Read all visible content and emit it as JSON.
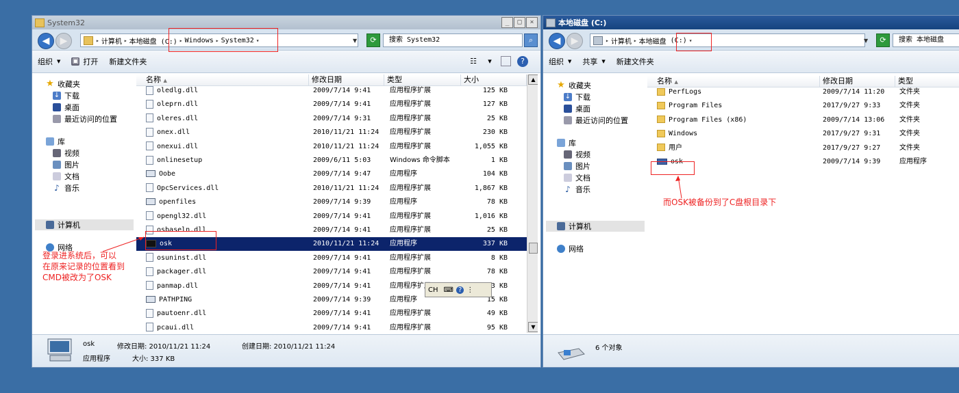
{
  "left_window": {
    "title": "System32",
    "address": [
      "计算机",
      "本地磁盘 (C:)",
      "Windows",
      "System32"
    ],
    "search_placeholder": "搜索 System32",
    "toolbar": {
      "organize": "组织",
      "open": "打开",
      "new_folder": "新建文件夹"
    },
    "nav": {
      "favorites": "收藏夹",
      "favorites_items": [
        "下载",
        "桌面",
        "最近访问的位置"
      ],
      "libraries": "库",
      "libraries_items": [
        "视频",
        "图片",
        "文档",
        "音乐"
      ],
      "computer": "计算机",
      "network": "网络"
    },
    "columns": {
      "name": "名称",
      "date": "修改日期",
      "type": "类型",
      "size": "大小"
    },
    "rows": [
      {
        "name": "oledlg.dll",
        "date": "2009/7/14 9:41",
        "type": "应用程序扩展",
        "size": "125 KB",
        "icon": "dll"
      },
      {
        "name": "oleprn.dll",
        "date": "2009/7/14 9:41",
        "type": "应用程序扩展",
        "size": "127 KB",
        "icon": "dll"
      },
      {
        "name": "oleres.dll",
        "date": "2009/7/14 9:31",
        "type": "应用程序扩展",
        "size": "25 KB",
        "icon": "dll"
      },
      {
        "name": "onex.dll",
        "date": "2010/11/21 11:24",
        "type": "应用程序扩展",
        "size": "230 KB",
        "icon": "dll"
      },
      {
        "name": "onexui.dll",
        "date": "2010/11/21 11:24",
        "type": "应用程序扩展",
        "size": "1,055 KB",
        "icon": "dll"
      },
      {
        "name": "onlinesetup",
        "date": "2009/6/11 5:03",
        "type": "Windows 命令脚本",
        "size": "1 KB",
        "icon": "dll"
      },
      {
        "name": "Oobe",
        "date": "2009/7/14 9:47",
        "type": "应用程序",
        "size": "104 KB",
        "icon": "exe"
      },
      {
        "name": "OpcServices.dll",
        "date": "2010/11/21 11:24",
        "type": "应用程序扩展",
        "size": "1,867 KB",
        "icon": "dll"
      },
      {
        "name": "openfiles",
        "date": "2009/7/14 9:39",
        "type": "应用程序",
        "size": "78 KB",
        "icon": "exe"
      },
      {
        "name": "opengl32.dll",
        "date": "2009/7/14 9:41",
        "type": "应用程序扩展",
        "size": "1,016 KB",
        "icon": "dll"
      },
      {
        "name": "osbaseln.dll",
        "date": "2009/7/14 9:41",
        "type": "应用程序扩展",
        "size": "25 KB",
        "icon": "dll"
      },
      {
        "name": "osk",
        "date": "2010/11/21 11:24",
        "type": "应用程序",
        "size": "337 KB",
        "icon": "cmd",
        "selected": true
      },
      {
        "name": "osuninst.dll",
        "date": "2009/7/14 9:41",
        "type": "应用程序扩展",
        "size": "8 KB",
        "icon": "dll"
      },
      {
        "name": "packager.dll",
        "date": "2009/7/14 9:41",
        "type": "应用程序扩展",
        "size": "78 KB",
        "icon": "dll"
      },
      {
        "name": "panmap.dll",
        "date": "2009/7/14 9:41",
        "type": "应用程序扩展",
        "size": "13 KB",
        "icon": "dll"
      },
      {
        "name": "PATHPING",
        "date": "2009/7/14 9:39",
        "type": "应用程序",
        "size": "15 KB",
        "icon": "exe"
      },
      {
        "name": "pautoenr.dll",
        "date": "2009/7/14 9:41",
        "type": "应用程序扩展",
        "size": "49 KB",
        "icon": "dll"
      },
      {
        "name": "pcaui.dll",
        "date": "2009/7/14 9:41",
        "type": "应用程序扩展",
        "size": "95 KB",
        "icon": "dll"
      }
    ],
    "details": {
      "name": "osk",
      "type": "应用程序",
      "modified": "修改日期: 2010/11/21 11:24",
      "created": "创建日期: 2010/11/21 11:24",
      "size": "大小: 337 KB"
    },
    "annotation": [
      "登录进系统后，可以",
      "在原来记录的位置看到",
      "CMD被改为了OSK"
    ]
  },
  "right_window": {
    "title": "本地磁盘 (C:)",
    "address": [
      "计算机",
      "本地磁盘",
      "(C:)"
    ],
    "search_placeholder": "搜索 本地磁盘",
    "toolbar": {
      "organize": "组织",
      "share": "共享",
      "new_folder": "新建文件夹"
    },
    "nav": {
      "favorites": "收藏夹",
      "favorites_items": [
        "下载",
        "桌面",
        "最近访问的位置"
      ],
      "libraries": "库",
      "libraries_items": [
        "视频",
        "图片",
        "文档",
        "音乐"
      ],
      "computer": "计算机",
      "network": "网络"
    },
    "columns": {
      "name": "名称",
      "date": "修改日期",
      "type": "类型"
    },
    "rows": [
      {
        "name": "PerfLogs",
        "date": "2009/7/14 11:20",
        "type": "文件夹",
        "icon": "folder"
      },
      {
        "name": "Program Files",
        "date": "2017/9/27 9:33",
        "type": "文件夹",
        "icon": "folder"
      },
      {
        "name": "Program Files (x86)",
        "date": "2009/7/14 13:06",
        "type": "文件夹",
        "icon": "folder"
      },
      {
        "name": "Windows",
        "date": "2017/9/27 9:31",
        "type": "文件夹",
        "icon": "folder"
      },
      {
        "name": "用户",
        "date": "2017/9/27 9:27",
        "type": "文件夹",
        "icon": "folder"
      },
      {
        "name": "osk",
        "date": "2009/7/14 9:39",
        "type": "应用程序",
        "icon": "kbd"
      }
    ],
    "status": "6 个对象",
    "annotation": "而OSK被备份到了C盘根目录下"
  },
  "ime": {
    "lang": "CH"
  }
}
